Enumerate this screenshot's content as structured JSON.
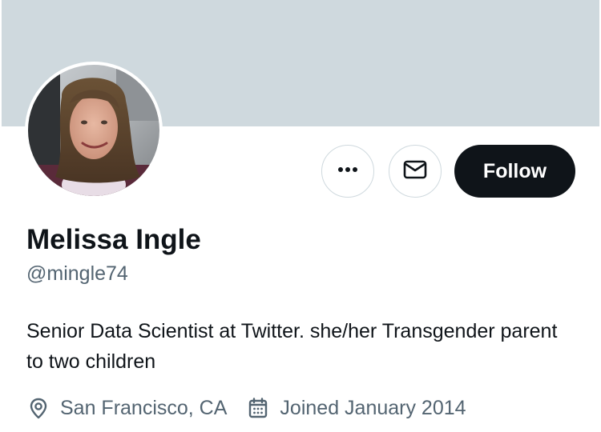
{
  "profile": {
    "name": "Melissa Ingle",
    "handle": "@mingle74",
    "bio": "Senior Data Scientist at Twitter. she/her Transgender parent to two children",
    "location": "San Francisco, CA",
    "joined": "Joined January 2014"
  },
  "actions": {
    "more_icon": "more-icon",
    "message_icon": "envelope-icon",
    "follow_label": "Follow"
  },
  "meta_icons": {
    "location": "location-pin-icon",
    "joined": "calendar-icon"
  },
  "colors": {
    "banner": "#cfd9de",
    "primary_text": "#0f1419",
    "secondary_text": "#536471",
    "button_border": "#cfd9de",
    "follow_bg": "#0f1419",
    "follow_text": "#ffffff"
  }
}
